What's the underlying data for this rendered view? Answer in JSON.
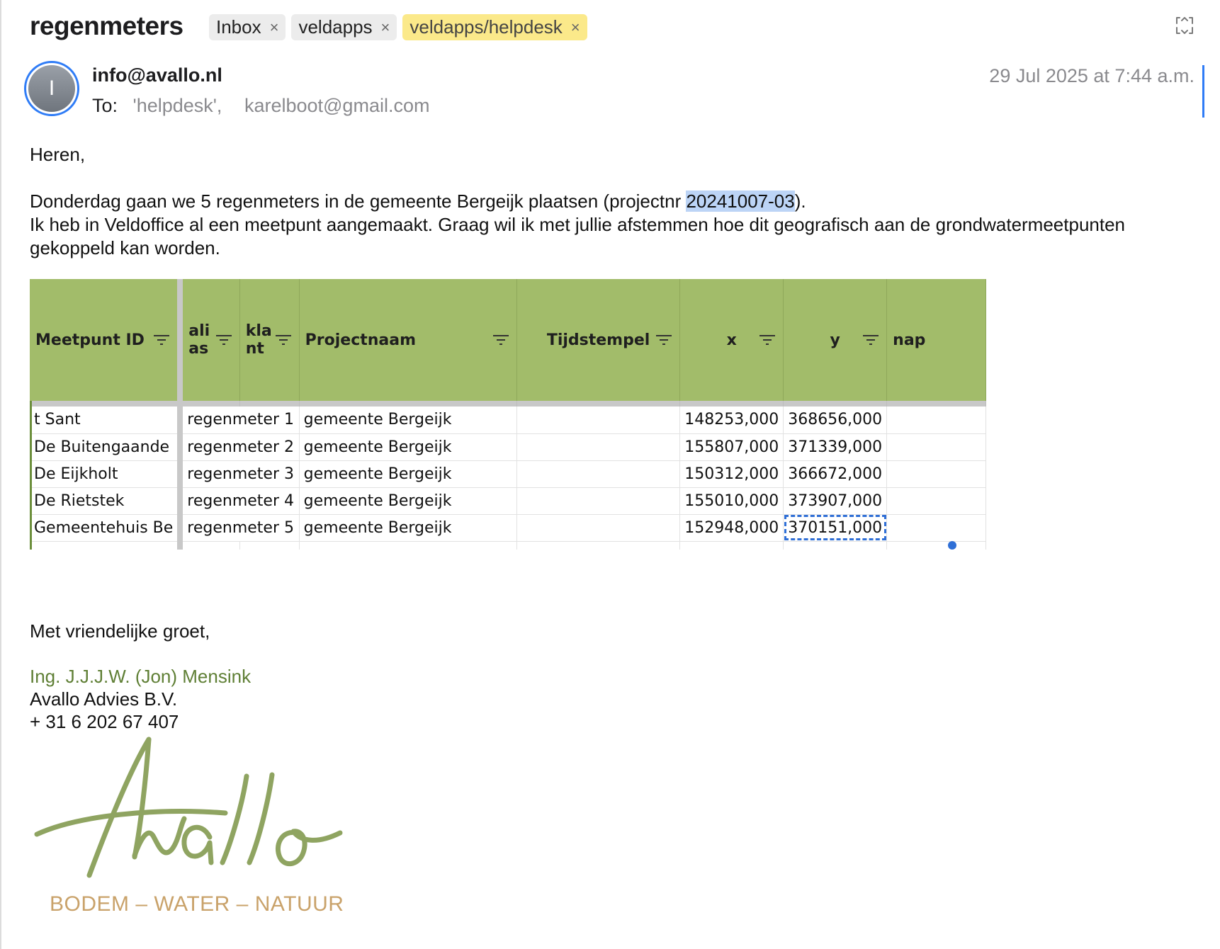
{
  "header": {
    "subject": "regenmeters",
    "tags": [
      {
        "label": "Inbox",
        "close": "×"
      },
      {
        "label": "veldapps",
        "close": "×"
      },
      {
        "label": "veldapps/helpdesk",
        "close": "×"
      }
    ]
  },
  "message": {
    "avatar_initial": "I",
    "from": "info@avallo.nl",
    "to_label": "To:",
    "recipients": [
      "'helpdesk',",
      "karelboot@gmail.com"
    ],
    "date": "29 Jul 2025 at 7:44 a.m."
  },
  "body": {
    "greeting": "Heren,",
    "line1_pre": "Donderdag gaan we 5 regenmeters in de gemeente Bergeijk plaatsen (projectnr ",
    "line1_selected": "20241007-03",
    "line1_post": ").",
    "line2": "Ik heb in Veldoffice al een meetpunt aangemaakt. Graag wil ik met jullie afstemmen hoe dit geografisch aan de grondwatermeetpunten gekoppeld kan worden."
  },
  "sheet": {
    "headers": [
      "Meetpunt ID",
      "ali\nas",
      "kla\nnt",
      "Projectnaam",
      "Tijdstempel",
      "x",
      "y",
      "nap"
    ],
    "rows": [
      [
        "t Sant",
        "regenmeter 1",
        "gemeente Bergeijk",
        "",
        "148253,000",
        "368656,000",
        ""
      ],
      [
        "De Buitengaande",
        "regenmeter 2",
        "gemeente Bergeijk",
        "",
        "155807,000",
        "371339,000",
        ""
      ],
      [
        "De Eijkholt",
        "regenmeter 3",
        "gemeente Bergeijk",
        "",
        "150312,000",
        "366672,000",
        ""
      ],
      [
        "De Rietstek",
        "regenmeter 4",
        "gemeente Bergeijk",
        "",
        "155010,000",
        "373907,000",
        ""
      ],
      [
        "Gemeentehuis Be",
        "regenmeter 5",
        "gemeente Bergeijk",
        "",
        "152948,000",
        "370151,000",
        ""
      ]
    ]
  },
  "signature": {
    "closing": "Met vriendelijke groet,",
    "name": "Ing. J.J.J.W. (Jon) Mensink",
    "company": "Avallo Advies B.V.",
    "phone": "+ 31 6 202 67 407",
    "logo_text": "Avallo",
    "tagline": "BODEM – WATER – NATUUR"
  },
  "colors": {
    "accent": "#2f7cf6",
    "tag_highlight": "#fbe98a",
    "sheet_header": "#a2bc6a",
    "signature_green": "#5f7f35",
    "logo_green": "#8fa461",
    "tagline_gold": "#c9a26a"
  },
  "icons": [
    "expand-icon",
    "star-icon",
    "reply-all-icon",
    "more-icon",
    "filter-icon"
  ]
}
